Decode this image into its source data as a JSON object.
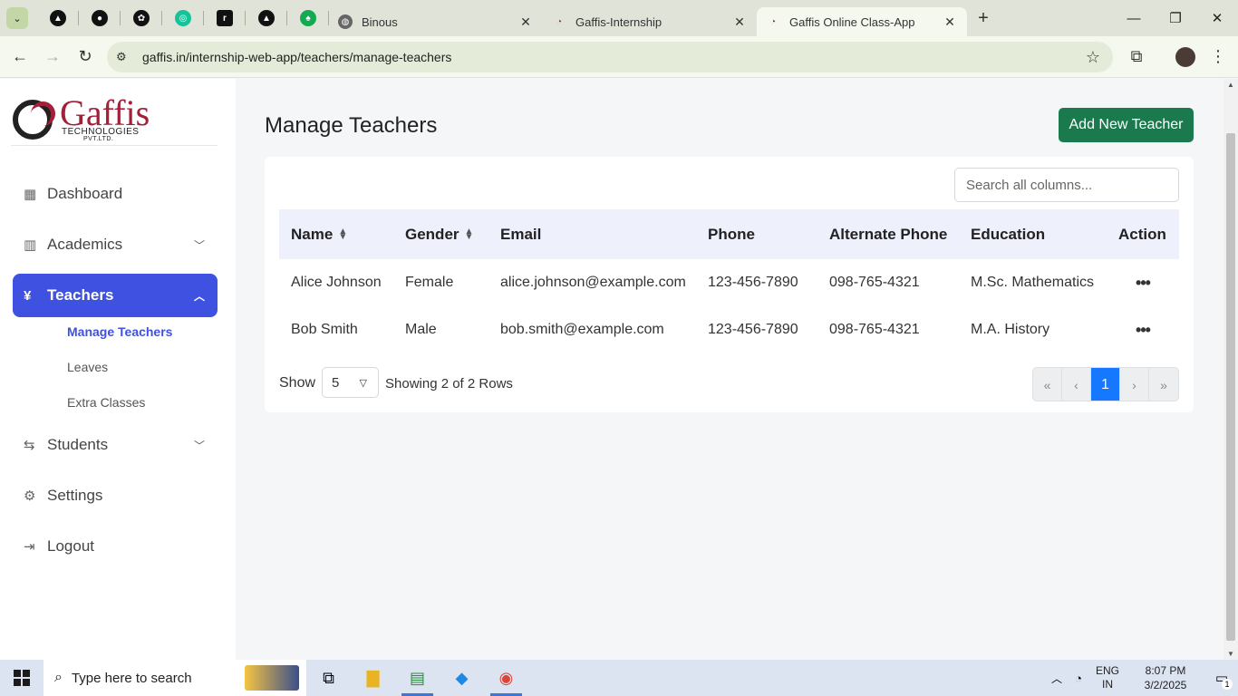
{
  "browser": {
    "pinned_tabs": [
      {
        "icon": "triangle-app-icon",
        "color": "#111111"
      },
      {
        "icon": "github-icon",
        "color": "#111111"
      },
      {
        "icon": "openai-icon",
        "color": "#111111"
      },
      {
        "icon": "grammarly-icon",
        "color": "#15c39a"
      },
      {
        "icon": "notion-icon",
        "color": "#111111"
      },
      {
        "icon": "vercel-icon",
        "color": "#111111"
      },
      {
        "icon": "mongodb-leaf-icon",
        "color": "#13aa52"
      }
    ],
    "tabs": [
      {
        "title": "Binous",
        "icon": "globe-icon",
        "active": false
      },
      {
        "title": "Gaffis-Internship",
        "icon": "gaffis-logo-icon",
        "active": false
      },
      {
        "title": "Gaffis Online Class-App",
        "icon": "gaffis-logo-icon",
        "active": true
      }
    ],
    "url": "gaffis.in/internship-web-app/teachers/manage-teachers"
  },
  "sidebar": {
    "logo": {
      "name": "Gaffis",
      "line1": "TECHNOLOGIES",
      "line2": "PVT.LTD."
    },
    "items": [
      {
        "label": "Dashboard",
        "icon": "grid-icon",
        "expandable": false
      },
      {
        "label": "Academics",
        "icon": "bar-chart-icon",
        "expandable": true
      },
      {
        "label": "Teachers",
        "icon": "yen-icon",
        "expandable": true,
        "active": true
      },
      {
        "label": "Students",
        "icon": "swap-icon",
        "expandable": true
      },
      {
        "label": "Settings",
        "icon": "gear-icon",
        "expandable": false
      },
      {
        "label": "Logout",
        "icon": "logout-icon",
        "expandable": false
      }
    ],
    "teachers_sub": [
      {
        "label": "Manage Teachers",
        "active": true
      },
      {
        "label": "Leaves",
        "active": false
      },
      {
        "label": "Extra Classes",
        "active": false
      }
    ]
  },
  "main": {
    "title": "Manage Teachers",
    "add_button": "Add New Teacher",
    "search_placeholder": "Search all columns...",
    "columns": [
      "Name",
      "Gender",
      "Email",
      "Phone",
      "Alternate Phone",
      "Education",
      "Action"
    ],
    "rows": [
      {
        "name": "Alice Johnson",
        "gender": "Female",
        "email": "alice.johnson@example.com",
        "phone": "123-456-7890",
        "alt_phone": "098-765-4321",
        "education": "M.Sc. Mathematics",
        "action": "•••"
      },
      {
        "name": "Bob Smith",
        "gender": "Male",
        "email": "bob.smith@example.com",
        "phone": "123-456-7890",
        "alt_phone": "098-765-4321",
        "education": "M.A. History",
        "action": "•••"
      }
    ],
    "footer": {
      "show_label": "Show",
      "page_size": "5",
      "rows_info": "Showing 2 of 2 Rows",
      "pager": [
        "«",
        "‹",
        "1",
        "›",
        "»"
      ],
      "current_page": "1"
    }
  },
  "taskbar": {
    "search_placeholder": "Type here to search",
    "lang": "ENG",
    "region": "IN",
    "time": "8:07 PM",
    "date": "3/2/2025",
    "notifications": "1"
  },
  "colors": {
    "accent": "#3f51e0",
    "add_button": "#1a7a4e",
    "brand": "#a32039",
    "pager_current": "#1677ff"
  }
}
